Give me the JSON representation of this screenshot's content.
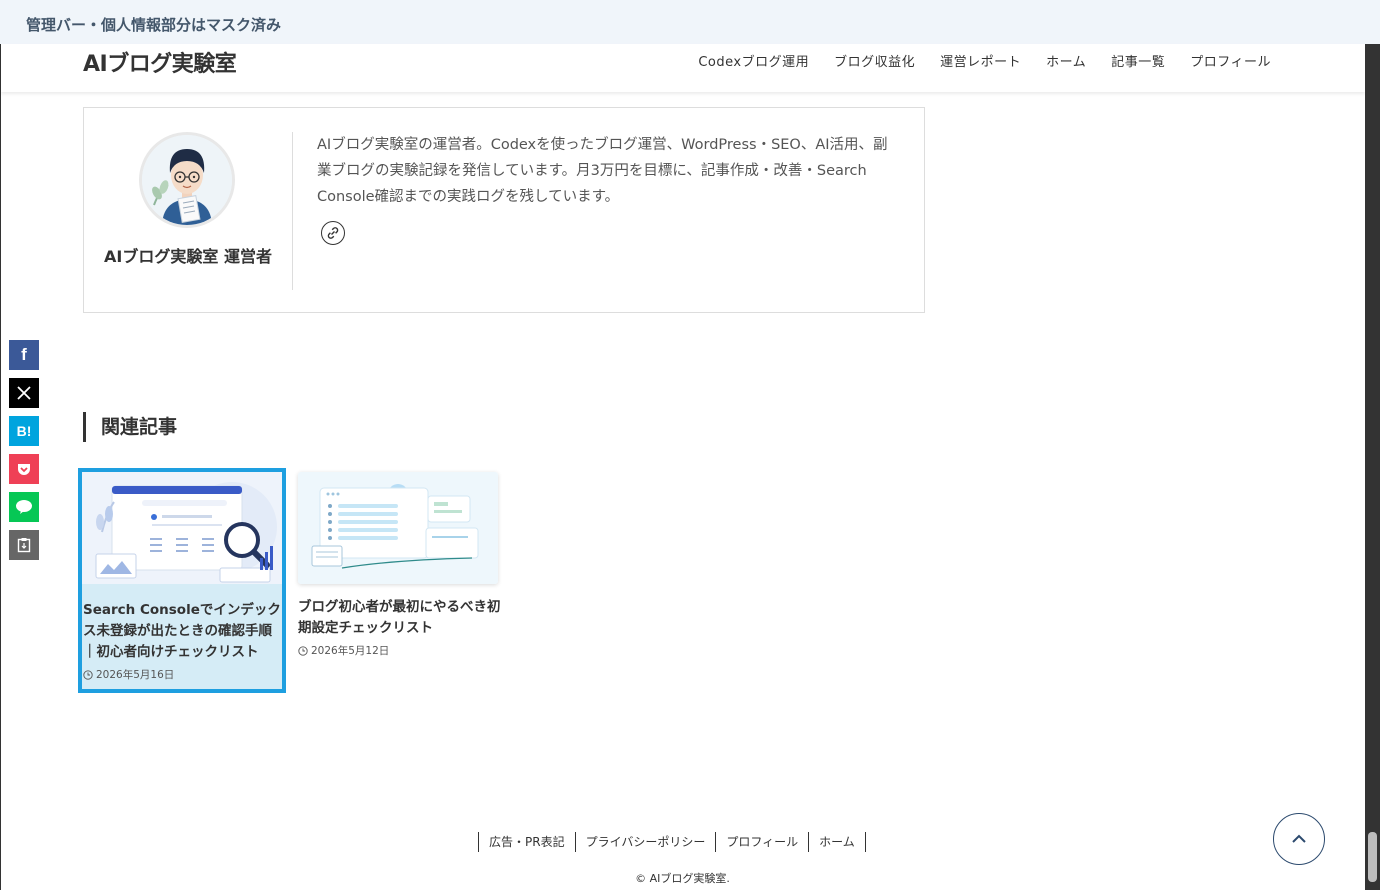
{
  "admin_bar": {
    "text": "管理バー・個人情報部分はマスク済み"
  },
  "header": {
    "site_title": "AIブログ実験室",
    "nav": [
      "Codexブログ運用",
      "ブログ収益化",
      "運営レポート",
      "ホーム",
      "記事一覧",
      "プロフィール"
    ]
  },
  "author": {
    "name": "AIブログ実験室 運営者",
    "bio": "AIブログ実験室の運営者。Codexを使ったブログ運営、WordPress・SEO、AI活用、副業ブログの実験記録を発信しています。月3万円を目標に、記事作成・改善・Search Console確認までの実践ログを残しています。"
  },
  "share": [
    "facebook-icon",
    "x-icon",
    "hatena-bookmark-icon",
    "pocket-icon",
    "line-icon",
    "copy-icon"
  ],
  "related": {
    "heading": "関連記事",
    "cards": [
      {
        "title": "Search Consoleでインデックス未登録が出たときの確認手順｜初心者向けチェックリスト",
        "date": "2026年5月16日"
      },
      {
        "title": "ブログ初心者が最初にやるべき初期設定チェックリスト",
        "date": "2026年5月12日"
      }
    ]
  },
  "footer": {
    "nav": [
      "広告・PR表記",
      "プライバシーポリシー",
      "プロフィール",
      "ホーム"
    ],
    "copyright": "© AIブログ実験室."
  },
  "colors": {
    "accent": "#1e9fe0",
    "admin_bar_bg": "#f0f5fa",
    "hover_card_bg": "#d5ecf6"
  }
}
